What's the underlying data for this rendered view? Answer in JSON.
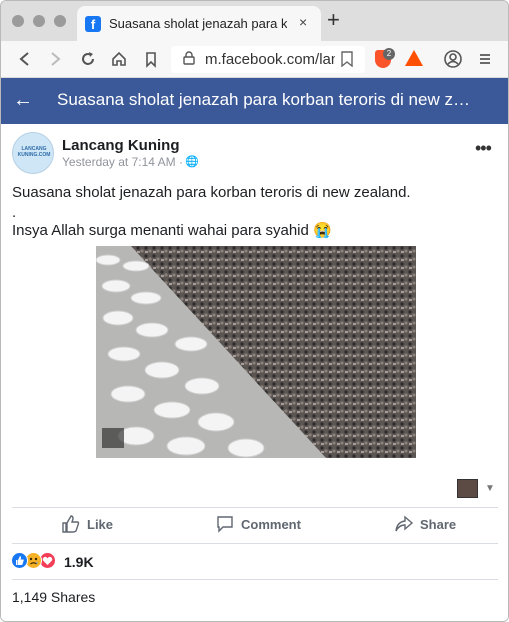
{
  "browser": {
    "tab_title": "Suasana sholat jenazah para kor",
    "tab_close": "×",
    "new_tab": "+",
    "url": "m.facebook.com/lanc",
    "favicon_letter": "f",
    "brave_badge": "2"
  },
  "header": {
    "back_icon": "←",
    "title": "Suasana sholat jenazah para korban teroris di new ze…"
  },
  "post": {
    "author": "Lancang Kuning",
    "avatar_text": "LANCANG KUNING.COM",
    "timestamp": "Yesterday at 7:14 AM",
    "separator": "·",
    "globe_icon": "🌐",
    "more_icon": "•••",
    "text_lines": [
      "Suasana sholat jenazah para korban teroris di new zealand.",
      ".",
      "Insya Allah surga menanti wahai para syahid 😭"
    ],
    "thumb_caret": "▼"
  },
  "actions": {
    "like": "Like",
    "comment": "Comment",
    "share": "Share"
  },
  "stats": {
    "reaction_count": "1.9K",
    "shares": "1,149 Shares"
  },
  "colors": {
    "facebook_blue": "#3b5998",
    "like_blue": "#1877f2",
    "love_red": "#f33e58",
    "sad_yellow": "#f7b125"
  }
}
